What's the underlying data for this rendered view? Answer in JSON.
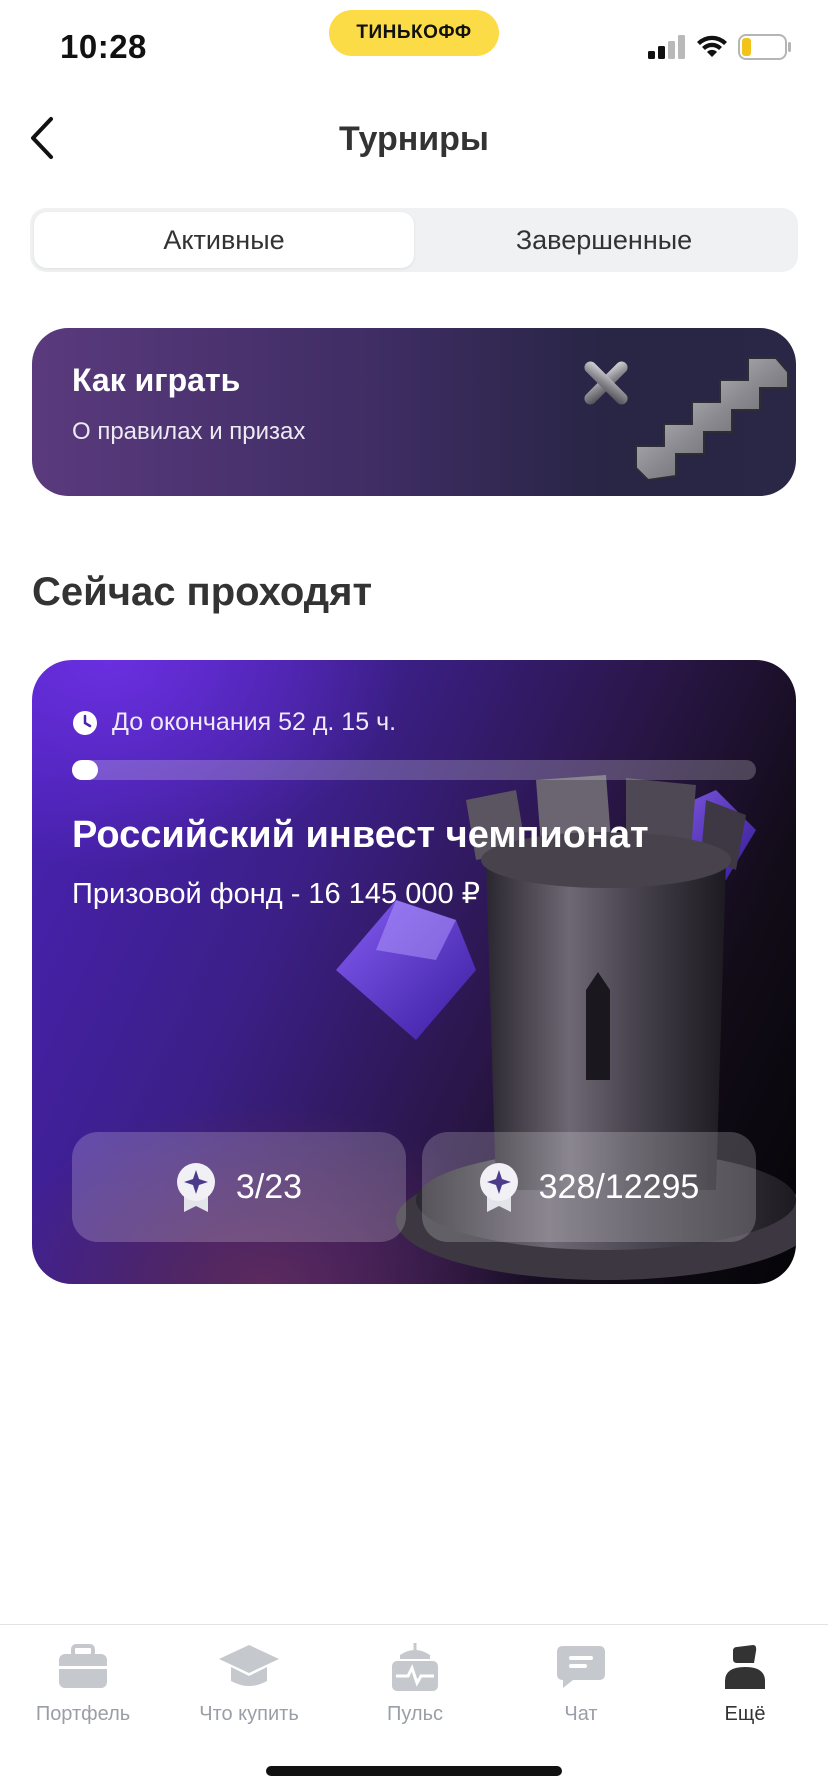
{
  "status_bar": {
    "time": "10:28",
    "brand": "ТИНЬКОФФ"
  },
  "header": {
    "title": "Турниры"
  },
  "tabs": [
    {
      "label": "Активные",
      "active": true
    },
    {
      "label": "Завершенные",
      "active": false
    }
  ],
  "how_to_play": {
    "title": "Как играть",
    "subtitle": "О правилах и призах"
  },
  "section": {
    "title": "Сейчас проходят"
  },
  "tournament": {
    "deadline": "До окончания 52 д. 15 ч.",
    "progress": 0.03,
    "title": "Российский инвест чемпионат",
    "prize": "Призовой фонд - 16 145 000 ₽",
    "stats": [
      {
        "icon": "award-badge-icon",
        "value": "3/23"
      },
      {
        "icon": "award-badge-icon",
        "value": "328/12295"
      }
    ]
  },
  "tabbar": {
    "items": [
      {
        "label": "Портфель",
        "icon": "briefcase-icon",
        "active": false
      },
      {
        "label": "Что купить",
        "icon": "graduation-cap-icon",
        "active": false
      },
      {
        "label": "Пульс",
        "icon": "pulse-icon",
        "active": false
      },
      {
        "label": "Чат",
        "icon": "chat-icon",
        "active": false
      },
      {
        "label": "Ещё",
        "icon": "profile-icon",
        "active": true
      }
    ]
  },
  "colors": {
    "brand_yellow": "#fcdc46",
    "card_purple": "#4a22b8",
    "text_dark": "#333333",
    "inactive": "#9a9ea6"
  }
}
